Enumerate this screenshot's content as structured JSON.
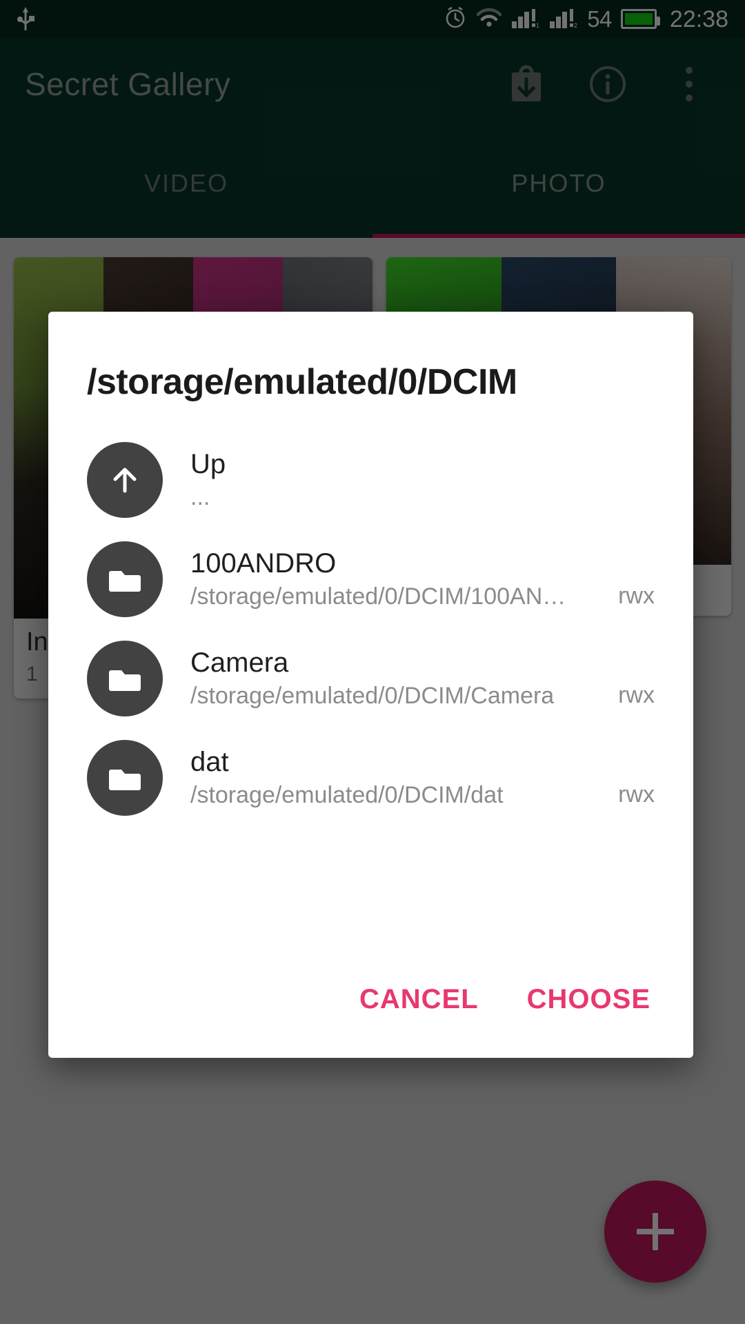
{
  "statusbar": {
    "usb_icon": "usb-icon",
    "alarm_icon": "alarm-icon",
    "wifi_icon": "wifi-icon",
    "signal1_icon": "signal-bars-sim1-icon",
    "signal2_icon": "signal-bars-sim2-icon",
    "battery_percent": "54",
    "battery_icon": "battery-full-icon",
    "clock": "22:38"
  },
  "appbar": {
    "title": "Secret Gallery",
    "actions": [
      {
        "name": "archive-download-icon",
        "label": "Import"
      },
      {
        "name": "info-icon",
        "label": "Info"
      },
      {
        "name": "overflow-menu-icon",
        "label": "More options"
      }
    ]
  },
  "tabs": {
    "items": [
      {
        "label": "VIDEO",
        "active": false
      },
      {
        "label": "PHOTO",
        "active": true
      }
    ],
    "indicator_color": "#c2185b"
  },
  "gallery": {
    "left_card": {
      "title": "In",
      "subtitle": "1"
    }
  },
  "fab": {
    "icon": "plus-icon",
    "color": "#c2185b"
  },
  "dialog": {
    "title": "/storage/emulated/0/DCIM",
    "items": [
      {
        "icon": "arrow-up-icon",
        "name": "Up",
        "path": "...",
        "perm": ""
      },
      {
        "icon": "folder-icon",
        "name": "100ANDRO",
        "path": "/storage/emulated/0/DCIM/100AN…",
        "perm": "rwx"
      },
      {
        "icon": "folder-icon",
        "name": "Camera",
        "path": "/storage/emulated/0/DCIM/Camera",
        "perm": "rwx"
      },
      {
        "icon": "folder-icon",
        "name": "dat",
        "path": "/storage/emulated/0/DCIM/dat",
        "perm": "rwx"
      }
    ],
    "cancel_label": "CANCEL",
    "choose_label": "CHOOSE",
    "action_color": "#e8386d"
  }
}
